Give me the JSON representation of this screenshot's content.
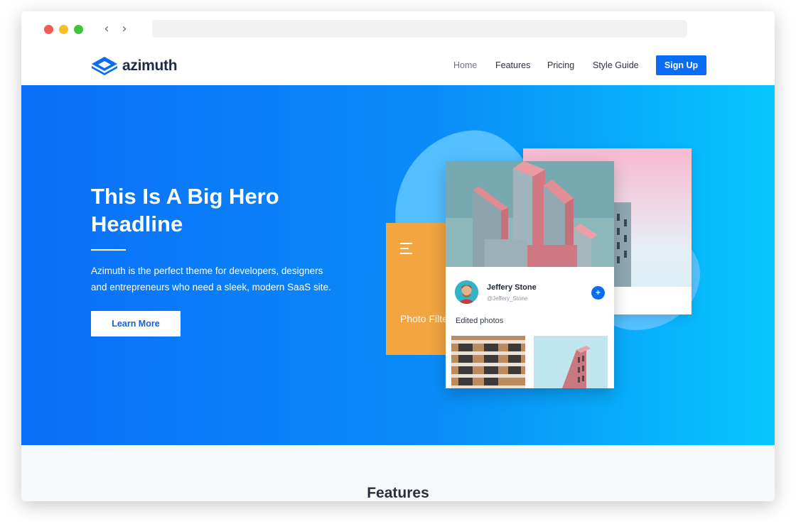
{
  "browser": {
    "back_icon": "chevron-left-icon",
    "forward_icon": "chevron-right-icon",
    "url": ""
  },
  "brand": {
    "name": "azimuth",
    "logo_color": "#0a6cf0"
  },
  "nav": {
    "items": [
      {
        "label": "Home",
        "active": true
      },
      {
        "label": "Features",
        "active": false
      },
      {
        "label": "Pricing",
        "active": false
      },
      {
        "label": "Style Guide",
        "active": false
      }
    ],
    "signup_label": "Sign Up"
  },
  "hero": {
    "headline": "This Is A Big Hero Headline",
    "description": "Azimuth is the perfect theme for developers, designers and entrepreneurs who need a sleek, modern SaaS site.",
    "cta_label": "Learn More",
    "gradient_start": "#0b6ef8",
    "gradient_end": "#07c7fd"
  },
  "illustration": {
    "orange_card_text": "Photo Filter Orange",
    "profile": {
      "name": "Jeffery Stone",
      "handle": "@Jeffery_Stone",
      "follow_icon": "plus-icon"
    },
    "section_label": "Edited photos"
  },
  "features": {
    "title": "Features"
  }
}
